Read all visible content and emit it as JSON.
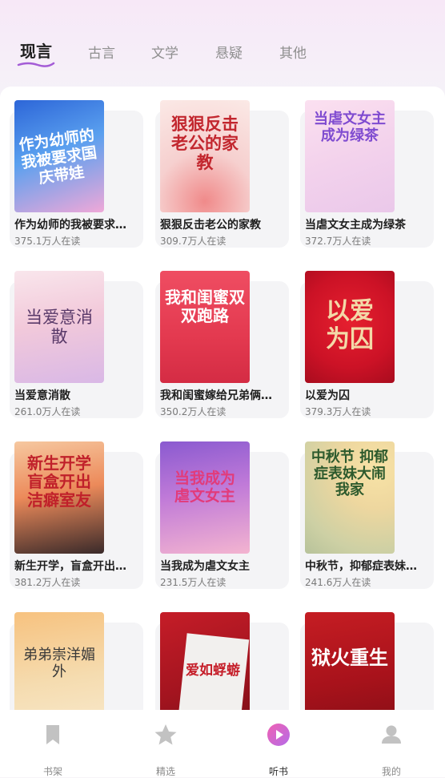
{
  "tabs": [
    {
      "label": "现言"
    },
    {
      "label": "古言"
    },
    {
      "label": "文学"
    },
    {
      "label": "悬疑"
    },
    {
      "label": "其他"
    }
  ],
  "books": [
    {
      "title": "作为幼师的我被要求国...",
      "count": "375.1万人在读",
      "cover_text": "作为幼师的我被要求国庆带娃",
      "cover_color": "#3a74e0"
    },
    {
      "title": "狠狠反击老公的家教",
      "count": "309.7万人在读",
      "cover_text": "狠狠反击老公的家教",
      "cover_color": "#f4c9c9"
    },
    {
      "title": "当虐文女主成为绿茶",
      "count": "372.7万人在读",
      "cover_text": "当虐文女主成为绿茶",
      "cover_color": "#f6d8ec"
    },
    {
      "title": "当爱意消散",
      "count": "261.0万人在读",
      "cover_text": "当爱意消散",
      "cover_color": "#f3d0dc"
    },
    {
      "title": "我和闺蜜嫁给兄弟俩后...",
      "count": "350.2万人在读",
      "cover_text": "我和闺蜜双双跑路",
      "cover_color": "#e8435a"
    },
    {
      "title": "以爱为囚",
      "count": "379.3万人在读",
      "cover_text": "以爱为囚",
      "cover_color": "#d9142a"
    },
    {
      "title": "新生开学，盲盒开出洁...",
      "count": "381.2万人在读",
      "cover_text": "新生开学盲盒开出洁癖室友",
      "cover_color": "#e0603a"
    },
    {
      "title": "当我成为虐文女主",
      "count": "231.5万人在读",
      "cover_text": "当我成为虐文女主",
      "cover_color": "#b77ad6"
    },
    {
      "title": "中秋节，抑郁症表妹大...",
      "count": "241.6万人在读",
      "cover_text": "中秋节 抑郁症表妹大闹我家",
      "cover_color": "#e8d7a0"
    },
    {
      "title": "",
      "count": "",
      "cover_text": "弟弟崇洋媚外",
      "cover_color": "#f7c27f"
    },
    {
      "title": "",
      "count": "",
      "cover_text": "爱如蜉蝣",
      "cover_color": "#c51d28"
    },
    {
      "title": "",
      "count": "",
      "cover_text": "狱火重生",
      "cover_color": "#c51d23"
    }
  ],
  "nav": [
    {
      "label": "书架",
      "icon": "bookmark-icon"
    },
    {
      "label": "精选",
      "icon": "star-icon"
    },
    {
      "label": "听书",
      "icon": "play-icon"
    },
    {
      "label": "我的",
      "icon": "user-icon"
    }
  ],
  "colors": {
    "accent": "#e9479a",
    "tab_underline": "#a45cd6"
  }
}
